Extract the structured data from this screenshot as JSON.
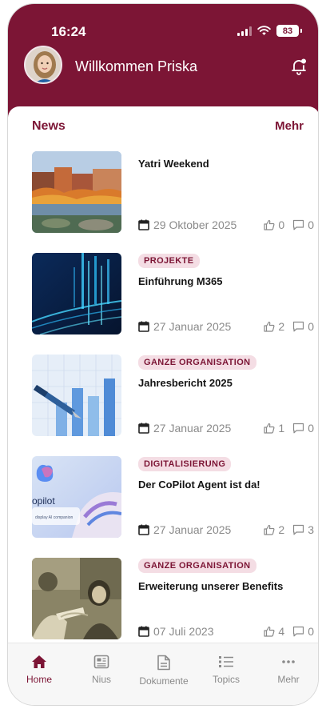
{
  "status": {
    "time": "16:24",
    "battery": "83"
  },
  "header": {
    "welcome": "Willkommen Priska"
  },
  "news": {
    "title": "News",
    "more": "Mehr",
    "items": [
      {
        "tag": "",
        "title": "Yatri Weekend",
        "date": "29 Oktober 2025",
        "likes": "0",
        "comments": "0"
      },
      {
        "tag": "PROJEKTE",
        "title": "Einführung M365",
        "date": "27 Januar 2025",
        "likes": "2",
        "comments": "0"
      },
      {
        "tag": "GANZE ORGANISATION",
        "title": "Jahresbericht 2025",
        "date": "27 Januar 2025",
        "likes": "1",
        "comments": "0"
      },
      {
        "tag": "DIGITALISIERUNG",
        "title": "Der CoPilot Agent ist da!",
        "date": "27 Januar 2025",
        "likes": "2",
        "comments": "3"
      },
      {
        "tag": "GANZE ORGANISATION",
        "title": "Erweiterung unserer Benefits",
        "date": "07 Juli 2023",
        "likes": "4",
        "comments": "0"
      }
    ]
  },
  "copilot_thumb": {
    "word": "opilot",
    "caption": "display AI companion"
  },
  "tabs": [
    {
      "label": "Home",
      "icon": "home-icon"
    },
    {
      "label": "Nius",
      "icon": "newspaper-icon"
    },
    {
      "label": "Dokumente",
      "icon": "document-icon"
    },
    {
      "label": "Topics",
      "icon": "list-icon"
    },
    {
      "label": "Mehr",
      "icon": "more-icon"
    }
  ],
  "colors": {
    "brand": "#7c1535",
    "tag_bg": "#f4dde4",
    "muted": "#8a8a8a"
  }
}
